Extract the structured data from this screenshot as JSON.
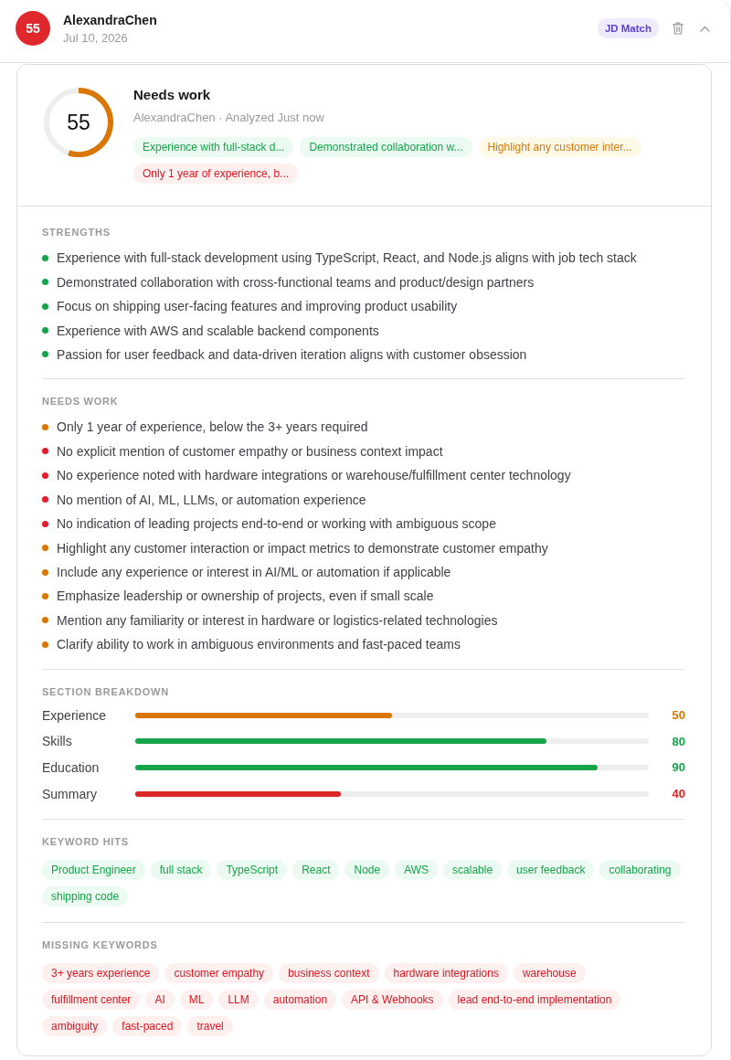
{
  "header": {
    "score": "55",
    "name": "AlexandraChen",
    "date": "Jul 10, 2026",
    "badge": "JD Match",
    "expanded": true
  },
  "summary": {
    "score": "55",
    "level": 0.55,
    "verdict": "Needs work",
    "subtitle": "AlexandraChen · Analyzed Just now",
    "chips": [
      {
        "text": "Experience with full-stack d...",
        "kind": "strength"
      },
      {
        "text": "Demonstrated collaboration w...",
        "kind": "strength"
      },
      {
        "text": "Highlight any customer inter...",
        "kind": "suggestion"
      },
      {
        "text": "Only 1 year of experience, b...",
        "kind": "gap"
      }
    ]
  },
  "strengths": {
    "title": "STRENGTHS",
    "items": [
      "Experience with full-stack development using TypeScript, React, and Node.js aligns with job tech stack",
      "Demonstrated collaboration with cross-functional teams and product/design partners",
      "Focus on shipping user-facing features and improving product usability",
      "Experience with AWS and scalable backend components",
      "Passion for user feedback and data-driven iteration aligns with customer obsession"
    ]
  },
  "needs_work": {
    "title": "NEEDS WORK",
    "items": [
      {
        "text": "Only 1 year of experience, below the 3+ years required",
        "color": "#d97706"
      },
      {
        "text": "No explicit mention of customer empathy or business context impact",
        "color": "#e11d2a"
      },
      {
        "text": "No experience noted with hardware integrations or warehouse/fulfillment center technology",
        "color": "#e11d2a"
      },
      {
        "text": "No mention of AI, ML, LLMs, or automation experience",
        "color": "#e11d2a"
      },
      {
        "text": "No indication of leading projects end-to-end or working with ambiguous scope",
        "color": "#e11d2a"
      },
      {
        "text": "Highlight any customer interaction or impact metrics to demonstrate customer empathy",
        "color": "#d97706"
      },
      {
        "text": "Include any experience or interest in AI/ML or automation if applicable",
        "color": "#d97706"
      },
      {
        "text": "Emphasize leadership or ownership of projects, even if small scale",
        "color": "#d97706"
      },
      {
        "text": "Mention any familiarity or interest in hardware or logistics-related technologies",
        "color": "#d97706"
      },
      {
        "text": "Clarify ability to work in ambiguous environments and fast-paced teams",
        "color": "#d97706"
      }
    ]
  },
  "breakdown": {
    "title": "SECTION BREAKDOWN",
    "rows": [
      {
        "label": "Experience",
        "level": 0.5,
        "value": "50",
        "color": "#d97706"
      },
      {
        "label": "Skills",
        "level": 0.8,
        "value": "80",
        "color": "#16a34a"
      },
      {
        "label": "Education",
        "level": 0.9,
        "value": "90",
        "color": "#16a34a"
      },
      {
        "label": "Summary",
        "level": 0.4,
        "value": "40",
        "color": "#dc2626"
      }
    ]
  },
  "keyword_hits": {
    "title": "KEYWORD HITS",
    "keywords": [
      "Product Engineer",
      "full stack",
      "TypeScript",
      "React",
      "Node",
      "AWS",
      "scalable",
      "user feedback",
      "collaborating",
      "shipping code"
    ]
  },
  "missing_keywords": {
    "title": "MISSING KEYWORDS",
    "keywords": [
      "3+ years experience",
      "customer empathy",
      "business context",
      "hardware integrations",
      "warehouse",
      "fulfillment center",
      "AI",
      "ML",
      "LLM",
      "automation",
      "API & Webhooks",
      "lead end-to-end implementation",
      "ambiguity",
      "fast-paced",
      "travel"
    ]
  }
}
